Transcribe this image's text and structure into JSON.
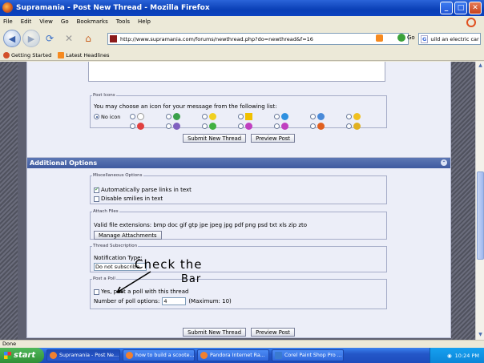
{
  "window": {
    "title": "Supramania - Post New Thread - Mozilla Firefox"
  },
  "menu": [
    "File",
    "Edit",
    "View",
    "Go",
    "Bookmarks",
    "Tools",
    "Help"
  ],
  "nav": {
    "url": "http://www.supramania.com/forums/newthread.php?do=newthread&f=16",
    "go_label": "Go",
    "search_value": "uild an electric car"
  },
  "bookmarks": [
    "Getting Started",
    "Latest Headlines"
  ],
  "post_icons": {
    "legend": "Post Icons",
    "text": "You may choose an icon for your message from the following list:",
    "no_icon_label": "No icon",
    "icon_colors_row1": [
      "#d8d8d8",
      "#3aa04a",
      "#f0d020",
      "#f0c000",
      "#2e90e0",
      "#4a8ad8",
      "#f0c020"
    ],
    "icon_colors_row2": [
      "#e04040",
      "#8060c0",
      "#40b040",
      "#c040c0",
      "#c040c0",
      "#e06020",
      "#e0b020"
    ]
  },
  "buttons": {
    "submit": "Submit New Thread",
    "preview": "Preview Post"
  },
  "additional": {
    "title": "Additional Options",
    "misc": {
      "legend": "Miscellaneous Options",
      "parse_links": "Automatically parse links in text",
      "disable_smilies": "Disable smilies in text"
    },
    "attach": {
      "legend": "Attach Files",
      "extensions": "Valid file extensions: bmp doc gif gtp jpe jpeg jpg pdf png psd txt xls zip zto",
      "manage": "Manage Attachments"
    },
    "subscription": {
      "legend": "Thread Subscription",
      "notification_label": "Notification Type:",
      "notification_value": "Do not subscribe"
    },
    "poll": {
      "legend": "Post a Poll",
      "checkbox_label": "Yes, post a poll with this thread",
      "options_label": "Number of poll options:",
      "options_value": "4",
      "max_label": "(Maximum: 10)"
    }
  },
  "annotation": {
    "line1": "Check the",
    "line2": "Bar"
  },
  "status": "Done",
  "taskbar": {
    "start": "start",
    "tasks": [
      "Supramania - Post Ne...",
      "how to build a scoote...",
      "Pandora Internet Ra...",
      "Corel Paint Shop Pro ..."
    ],
    "clock": "10:24 PM"
  }
}
